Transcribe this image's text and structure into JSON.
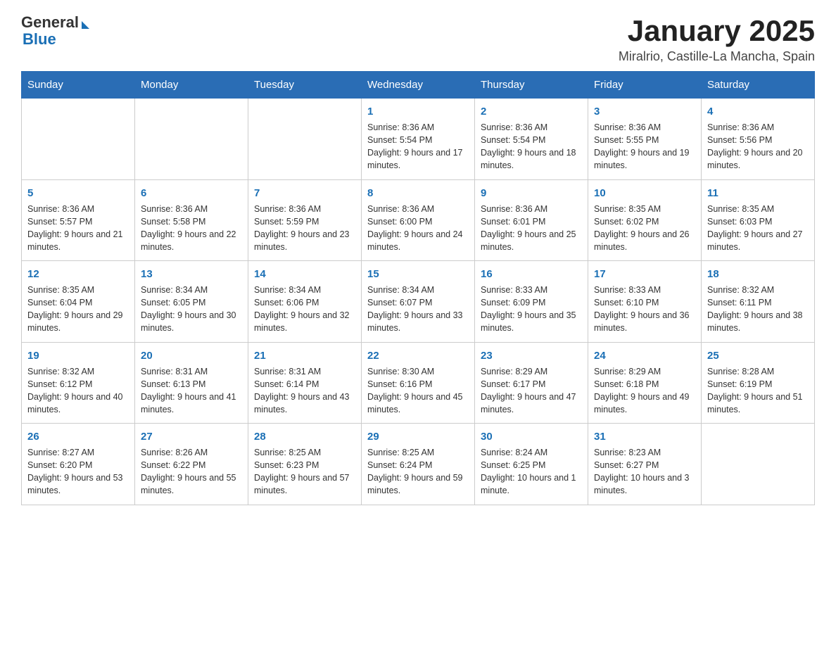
{
  "logo": {
    "general": "General",
    "blue": "Blue"
  },
  "title": "January 2025",
  "subtitle": "Miralrio, Castille-La Mancha, Spain",
  "headers": [
    "Sunday",
    "Monday",
    "Tuesday",
    "Wednesday",
    "Thursday",
    "Friday",
    "Saturday"
  ],
  "weeks": [
    [
      {
        "day": "",
        "info": ""
      },
      {
        "day": "",
        "info": ""
      },
      {
        "day": "",
        "info": ""
      },
      {
        "day": "1",
        "info": "Sunrise: 8:36 AM\nSunset: 5:54 PM\nDaylight: 9 hours and 17 minutes."
      },
      {
        "day": "2",
        "info": "Sunrise: 8:36 AM\nSunset: 5:54 PM\nDaylight: 9 hours and 18 minutes."
      },
      {
        "day": "3",
        "info": "Sunrise: 8:36 AM\nSunset: 5:55 PM\nDaylight: 9 hours and 19 minutes."
      },
      {
        "day": "4",
        "info": "Sunrise: 8:36 AM\nSunset: 5:56 PM\nDaylight: 9 hours and 20 minutes."
      }
    ],
    [
      {
        "day": "5",
        "info": "Sunrise: 8:36 AM\nSunset: 5:57 PM\nDaylight: 9 hours and 21 minutes."
      },
      {
        "day": "6",
        "info": "Sunrise: 8:36 AM\nSunset: 5:58 PM\nDaylight: 9 hours and 22 minutes."
      },
      {
        "day": "7",
        "info": "Sunrise: 8:36 AM\nSunset: 5:59 PM\nDaylight: 9 hours and 23 minutes."
      },
      {
        "day": "8",
        "info": "Sunrise: 8:36 AM\nSunset: 6:00 PM\nDaylight: 9 hours and 24 minutes."
      },
      {
        "day": "9",
        "info": "Sunrise: 8:36 AM\nSunset: 6:01 PM\nDaylight: 9 hours and 25 minutes."
      },
      {
        "day": "10",
        "info": "Sunrise: 8:35 AM\nSunset: 6:02 PM\nDaylight: 9 hours and 26 minutes."
      },
      {
        "day": "11",
        "info": "Sunrise: 8:35 AM\nSunset: 6:03 PM\nDaylight: 9 hours and 27 minutes."
      }
    ],
    [
      {
        "day": "12",
        "info": "Sunrise: 8:35 AM\nSunset: 6:04 PM\nDaylight: 9 hours and 29 minutes."
      },
      {
        "day": "13",
        "info": "Sunrise: 8:34 AM\nSunset: 6:05 PM\nDaylight: 9 hours and 30 minutes."
      },
      {
        "day": "14",
        "info": "Sunrise: 8:34 AM\nSunset: 6:06 PM\nDaylight: 9 hours and 32 minutes."
      },
      {
        "day": "15",
        "info": "Sunrise: 8:34 AM\nSunset: 6:07 PM\nDaylight: 9 hours and 33 minutes."
      },
      {
        "day": "16",
        "info": "Sunrise: 8:33 AM\nSunset: 6:09 PM\nDaylight: 9 hours and 35 minutes."
      },
      {
        "day": "17",
        "info": "Sunrise: 8:33 AM\nSunset: 6:10 PM\nDaylight: 9 hours and 36 minutes."
      },
      {
        "day": "18",
        "info": "Sunrise: 8:32 AM\nSunset: 6:11 PM\nDaylight: 9 hours and 38 minutes."
      }
    ],
    [
      {
        "day": "19",
        "info": "Sunrise: 8:32 AM\nSunset: 6:12 PM\nDaylight: 9 hours and 40 minutes."
      },
      {
        "day": "20",
        "info": "Sunrise: 8:31 AM\nSunset: 6:13 PM\nDaylight: 9 hours and 41 minutes."
      },
      {
        "day": "21",
        "info": "Sunrise: 8:31 AM\nSunset: 6:14 PM\nDaylight: 9 hours and 43 minutes."
      },
      {
        "day": "22",
        "info": "Sunrise: 8:30 AM\nSunset: 6:16 PM\nDaylight: 9 hours and 45 minutes."
      },
      {
        "day": "23",
        "info": "Sunrise: 8:29 AM\nSunset: 6:17 PM\nDaylight: 9 hours and 47 minutes."
      },
      {
        "day": "24",
        "info": "Sunrise: 8:29 AM\nSunset: 6:18 PM\nDaylight: 9 hours and 49 minutes."
      },
      {
        "day": "25",
        "info": "Sunrise: 8:28 AM\nSunset: 6:19 PM\nDaylight: 9 hours and 51 minutes."
      }
    ],
    [
      {
        "day": "26",
        "info": "Sunrise: 8:27 AM\nSunset: 6:20 PM\nDaylight: 9 hours and 53 minutes."
      },
      {
        "day": "27",
        "info": "Sunrise: 8:26 AM\nSunset: 6:22 PM\nDaylight: 9 hours and 55 minutes."
      },
      {
        "day": "28",
        "info": "Sunrise: 8:25 AM\nSunset: 6:23 PM\nDaylight: 9 hours and 57 minutes."
      },
      {
        "day": "29",
        "info": "Sunrise: 8:25 AM\nSunset: 6:24 PM\nDaylight: 9 hours and 59 minutes."
      },
      {
        "day": "30",
        "info": "Sunrise: 8:24 AM\nSunset: 6:25 PM\nDaylight: 10 hours and 1 minute."
      },
      {
        "day": "31",
        "info": "Sunrise: 8:23 AM\nSunset: 6:27 PM\nDaylight: 10 hours and 3 minutes."
      },
      {
        "day": "",
        "info": ""
      }
    ]
  ]
}
